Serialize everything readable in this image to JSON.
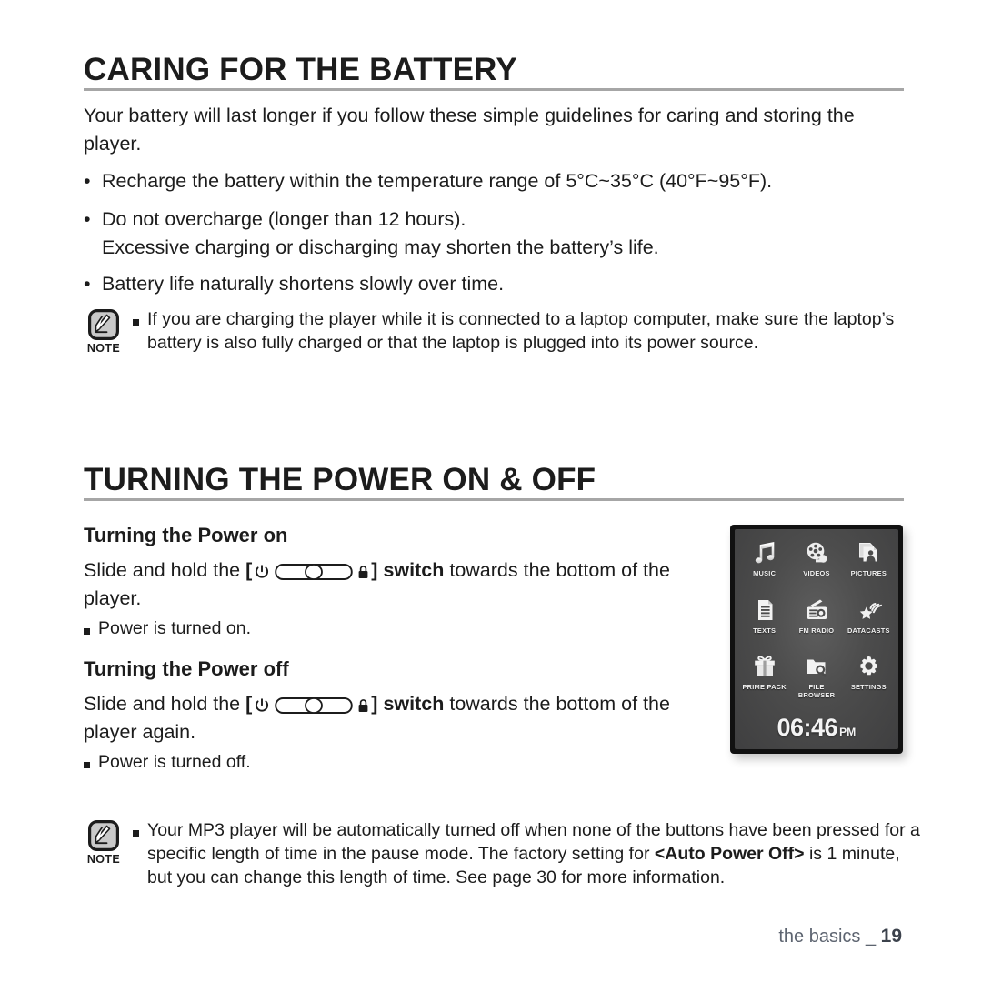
{
  "page": {
    "footer_text": "the basics _",
    "footer_page_number": "19"
  },
  "sections": [
    {
      "id": "caring-for-the-battery",
      "heading": "CARING FOR THE BATTERY",
      "intro": "Your battery will last longer if you follow these simple guidelines for caring and storing the player.",
      "bullets": [
        "Recharge the battery within the temperature range of 5°C~35°C (40°F~95°F).",
        "Do not overcharge (longer than 12 hours).\nExcessive charging or discharging may shorten the battery’s life.",
        "Battery life naturally shortens slowly over time."
      ],
      "note": {
        "label": "NOTE",
        "icon": "note-pen-icon",
        "items": [
          "If you are charging the player while it is connected to a laptop computer, make sure the laptop’s battery is also fully charged or that the laptop is plugged into its power source."
        ]
      }
    },
    {
      "id": "turning-the-power-on-off",
      "heading": "TURNING THE POWER ON & OFF",
      "power_on": {
        "subheading": "Turning the Power on",
        "instruction_prefix": "Slide and hold the",
        "instruction_bracket_open": "[",
        "instruction_bracket_close": "]",
        "instruction_switch_word": "switch",
        "instruction_suffix": "towards the bottom of the player.",
        "result": "Power is turned on."
      },
      "power_off": {
        "subheading": "Turning the Power off",
        "instruction_prefix": "Slide and hold the",
        "instruction_bracket_open": "[",
        "instruction_bracket_close": "]",
        "instruction_switch_word": "switch",
        "instruction_suffix": "towards the bottom of the player again.",
        "result": "Power is turned off."
      },
      "note": {
        "label": "NOTE",
        "icon": "note-pen-icon",
        "text_part1": "Your MP3 player will be automatically turned off when none of the buttons have been pressed for a specific length of time in the pause mode. The factory setting for ",
        "text_bold": "<Auto Power Off>",
        "text_part2": " is 1 minute, but you can change this length of time. See page 30 for more information."
      }
    }
  ],
  "device": {
    "name": "mp3-player-main-menu",
    "screen_background_color": "#4c4c4c",
    "bezel_color": "#111111",
    "menu_items": [
      {
        "label": "MUSIC",
        "icon": "music-note-icon"
      },
      {
        "label": "VIDEOS",
        "icon": "film-reel-icon"
      },
      {
        "label": "PICTURES",
        "icon": "picture-portrait-icon"
      },
      {
        "label": "TEXTS",
        "icon": "text-document-icon"
      },
      {
        "label": "FM RADIO",
        "icon": "radio-icon"
      },
      {
        "label": "DATACASTS",
        "icon": "star-broadcast-icon"
      },
      {
        "label": "PRIME PACK",
        "icon": "gift-box-icon"
      },
      {
        "label": "FILE\nBROWSER",
        "icon": "folder-search-icon"
      },
      {
        "label": "SETTINGS",
        "icon": "gear-icon"
      }
    ],
    "clock": {
      "time": "06:46",
      "ampm": "PM"
    }
  },
  "switch_glyph": {
    "power_symbol": "power-icon",
    "slider": "slider-track-icon",
    "lock_symbol": "lock-icon"
  }
}
